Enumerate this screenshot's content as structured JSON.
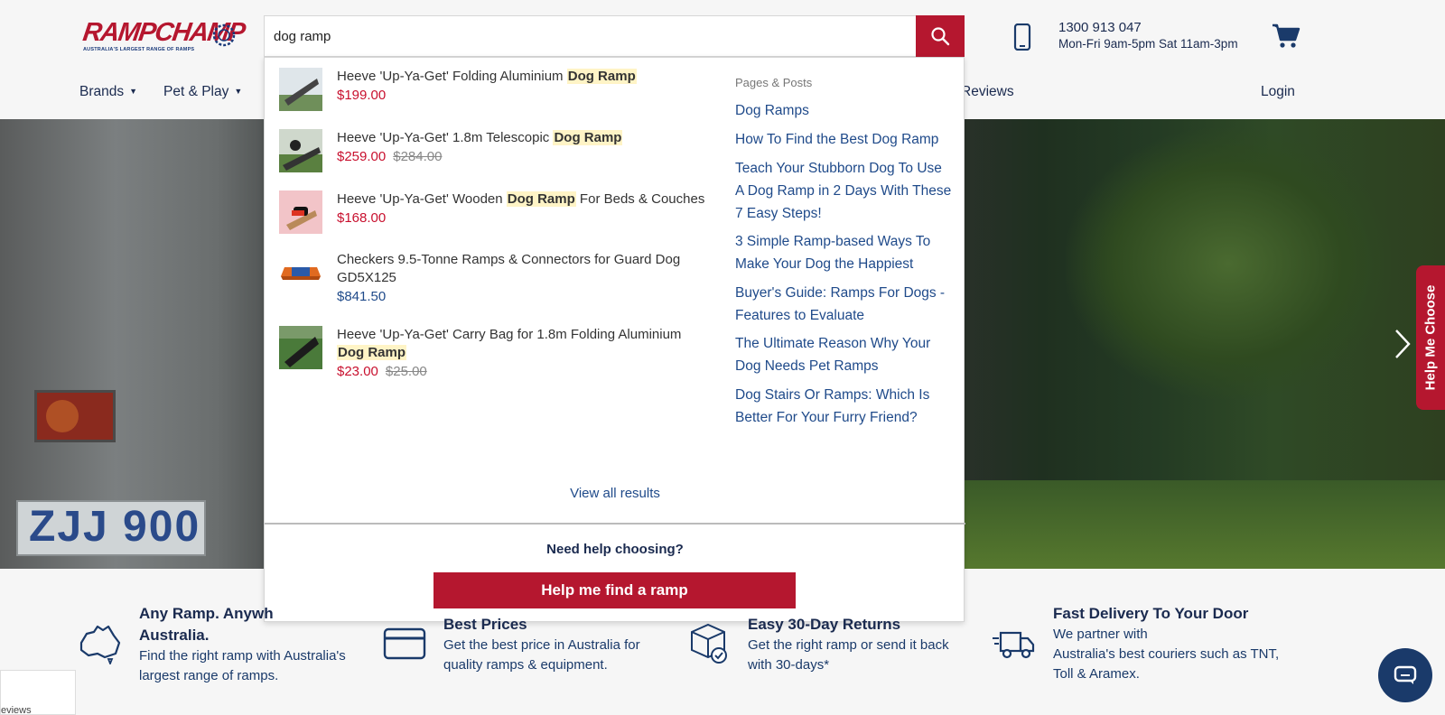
{
  "logo": {
    "name_part1": "RAMP",
    "name_part2": "CHAMP",
    "tagline": "AUSTRALIA'S LARGEST RANGE OF RAMPS"
  },
  "search": {
    "value": "dog ramp"
  },
  "contact": {
    "phone": "1300 913 047",
    "hours": "Mon-Fri 9am-5pm Sat 11am-3pm"
  },
  "nav": {
    "brands": "Brands",
    "pet_play": "Pet & Play",
    "reviews": "Reviews",
    "login": "Login"
  },
  "products": [
    {
      "name_before": "Heeve 'Up-Ya-Get' Folding Aluminium ",
      "highlight": "Dog Ramp",
      "name_after": "",
      "price": "$199.00",
      "old_price": ""
    },
    {
      "name_before": "Heeve 'Up-Ya-Get' 1.8m Telescopic ",
      "highlight": "Dog Ramp",
      "name_after": "",
      "price": "$259.00",
      "old_price": "$284.00"
    },
    {
      "name_before": "Heeve 'Up-Ya-Get' Wooden ",
      "highlight": "Dog Ramp",
      "name_after": " For Beds & Couches",
      "price": "$168.00",
      "old_price": ""
    },
    {
      "name_before": "Checkers 9.5-Tonne Ramps & Connectors for Guard Dog GD5X125",
      "highlight": "",
      "name_after": "",
      "price": "$841.50",
      "old_price": ""
    },
    {
      "name_before": "Heeve 'Up-Ya-Get' Carry Bag for 1.8m Folding Aluminium ",
      "highlight": "Dog Ramp",
      "name_after": "",
      "price": "$23.00",
      "old_price": "$25.00"
    }
  ],
  "pages_posts": {
    "heading": "Pages & Posts",
    "links": [
      "Dog Ramps",
      "How To Find the Best Dog Ramp",
      "Teach Your Stubborn Dog To Use A Dog Ramp in 2 Days With These 7 Easy Steps!",
      "3 Simple Ramp-based Ways To Make Your Dog the Happiest",
      "Buyer's Guide: Ramps For Dogs - Features to Evaluate",
      "The Ultimate Reason Why Your Dog Needs Pet Ramps",
      "Dog Stairs Or Ramps: Which Is Better For Your Furry Friend?"
    ]
  },
  "dropdown": {
    "view_all": "View all results",
    "need_help": "Need help choosing?",
    "help_button": "Help me find a ramp"
  },
  "hero": {
    "plate_text": "ZJJ 900",
    "help_tab": "Help Me Choose"
  },
  "features": [
    {
      "title": "Any Ramp. Anywhere in Australia.",
      "title_visible": "Any Ramp. Anywh",
      "title_line2": "Australia.",
      "desc": "Find the right ramp with Australia's largest range of ramps."
    },
    {
      "title": "Best Prices",
      "desc": "Get the best price in Australia for quality ramps & equipment."
    },
    {
      "title": "Easy 30-Day Returns",
      "desc": "Get the right ramp or send it back with 30-days*"
    },
    {
      "title": "Fast Delivery To Your Door",
      "desc_line1": "We partner with",
      "desc": "Australia's best couriers such as TNT, Toll & Aramex."
    }
  ],
  "reviews_widget": {
    "label": "eviews"
  },
  "colors": {
    "brand_red": "#b5172f",
    "navy": "#1a2a4f",
    "link_blue": "#1f4a8a",
    "price_red": "#c8102e",
    "highlight": "#fff4c6"
  }
}
